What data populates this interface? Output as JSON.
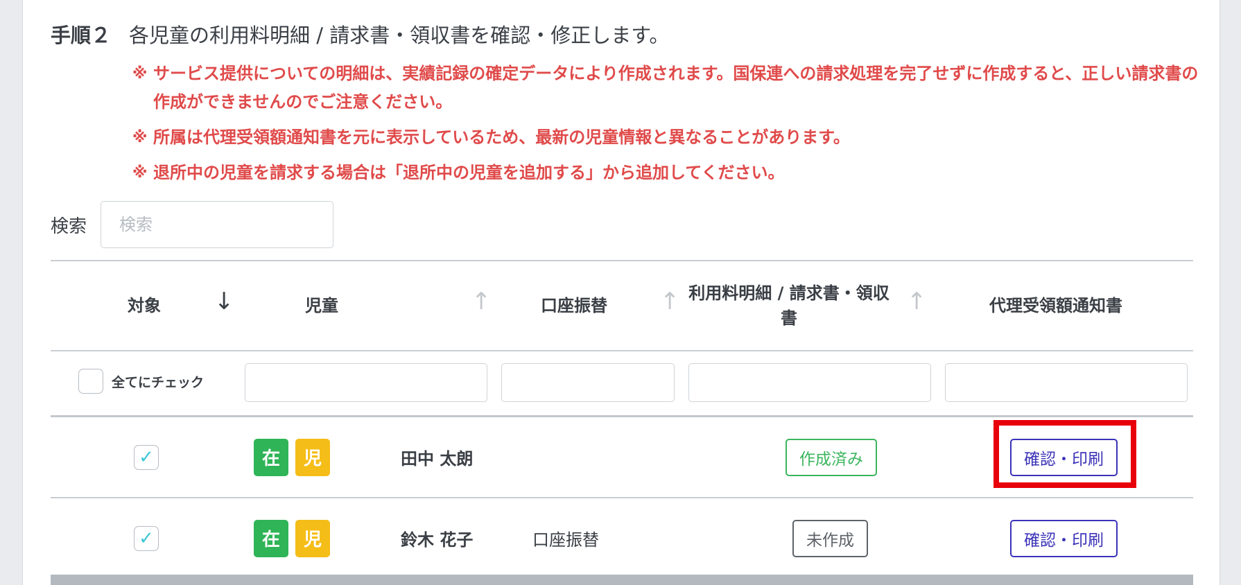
{
  "step": {
    "label": "手順２",
    "text": "各児童の利用料明細 / 請求書・領収書を確認・修正します。"
  },
  "notes": [
    {
      "mark": "※",
      "text": "サービス提供についての明細は、実績記録の確定データにより作成されます。国保連への請求処理を完了せずに作成すると、正しい請求書の作成ができませんのでご注意ください。"
    },
    {
      "mark": "※",
      "text": "所属は代理受領額通知書を元に表示しているため、最新の児童情報と異なることがあります。"
    },
    {
      "mark": "※",
      "text": "退所中の児童を請求する場合は「退所中の児童を追加する」から追加してください。"
    }
  ],
  "search": {
    "label": "検索",
    "placeholder": "検索",
    "value": ""
  },
  "columns": {
    "target": "対象",
    "child": "児童",
    "transfer": "口座振替",
    "invoice": "利用料明細 / 請求書・領収書",
    "notice": "代理受領額通知書"
  },
  "sort_icons": {
    "target": "↓",
    "child": "↑",
    "transfer": "↑",
    "invoice": "↑"
  },
  "filters": {
    "check_all_label": "全てにチェック",
    "check_all_checked": false,
    "child_value": "",
    "transfer_value": "",
    "invoice_value": "",
    "notice_value": ""
  },
  "rows": [
    {
      "checked": true,
      "check_glyph": "✓",
      "badges": [
        "在",
        "児"
      ],
      "name": "田中 太朗",
      "transfer": "",
      "status": "作成済み",
      "action": "確認・印刷"
    },
    {
      "checked": true,
      "check_glyph": "✓",
      "badges": [
        "在",
        "児"
      ],
      "name": "鈴木 花子",
      "transfer": "口座振替",
      "status": "未作成",
      "action": "確認・印刷"
    }
  ],
  "colors": {
    "accent": "#3b32b8",
    "warning": "#e04a4a",
    "done": "#3cb55e",
    "badge_green": "#2fb457",
    "badge_yellow": "#f5bd18",
    "highlight": "#e8000b"
  }
}
